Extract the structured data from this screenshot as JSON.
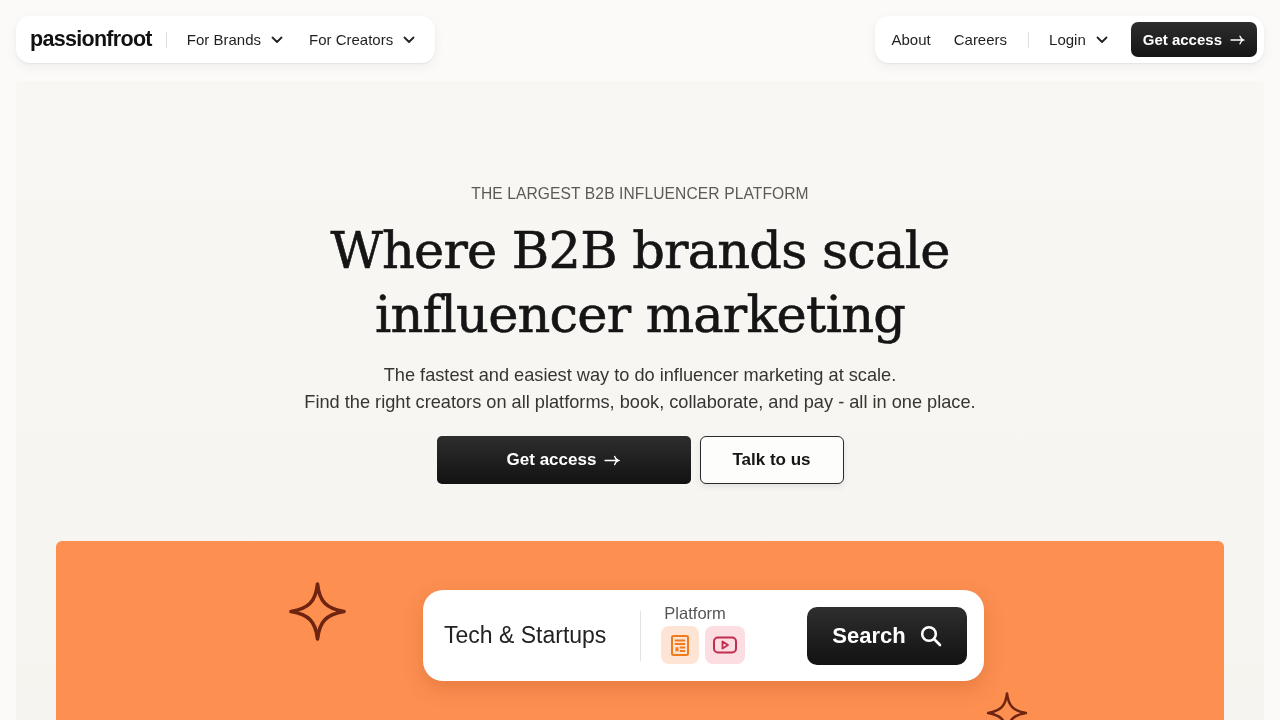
{
  "nav": {
    "logo": "passionfroot",
    "menus": [
      {
        "label": "For Brands",
        "dropdown": true
      },
      {
        "label": "For Creators",
        "dropdown": true
      }
    ],
    "links": [
      {
        "label": "About"
      },
      {
        "label": "Careers"
      }
    ],
    "login": {
      "label": "Login",
      "dropdown": true
    },
    "cta": "Get access"
  },
  "hero": {
    "eyebrow": "THE LARGEST B2B INFLUENCER PLATFORM",
    "headline_lines": [
      "Where B2B brands scale",
      "influencer marketing"
    ],
    "subtitle_lines": [
      "The fastest and easiest way to do influencer marketing at scale.",
      "Find the right creators on all platforms, book, collaborate, and pay - all in one place."
    ],
    "buttons": [
      {
        "label": "Get access",
        "kind": "primary"
      },
      {
        "label": "Talk to us",
        "kind": "secondary"
      }
    ]
  },
  "search": {
    "query": "Tech & Startups",
    "platform_label": "Platform",
    "button": "Search"
  }
}
